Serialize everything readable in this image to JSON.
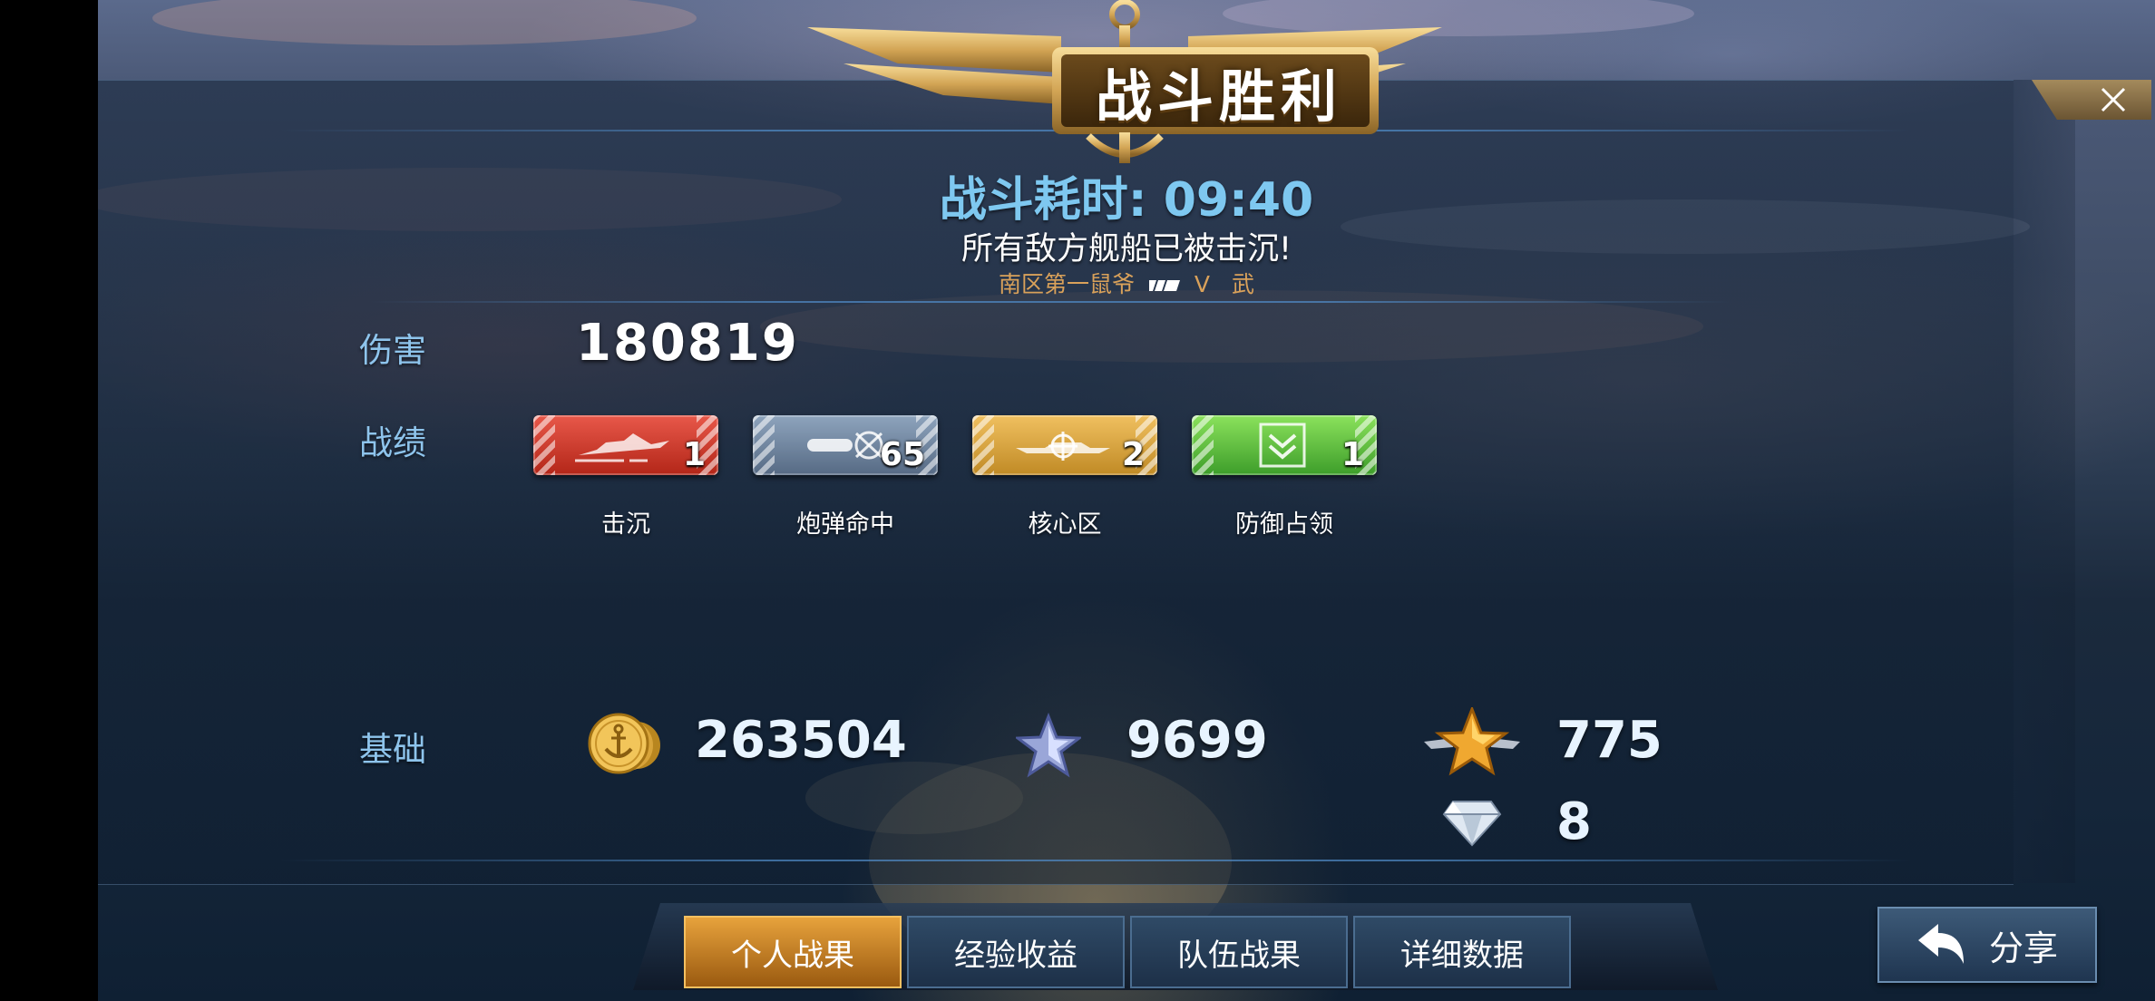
{
  "banner": {
    "title": "战斗胜利"
  },
  "battle": {
    "time_label": "战斗耗时:",
    "time_value": "09:40",
    "message": "所有敌方舰船已被击沉!",
    "mvp_name": "南区第一鼠爷",
    "mvp_rank": "V",
    "mvp_class": "武"
  },
  "damage": {
    "label": "伤害",
    "value": "180819"
  },
  "record": {
    "label": "战绩",
    "medals": [
      {
        "icon": "sunk-ship-icon",
        "count": "1",
        "caption": "击沉",
        "color": "#d33a2b"
      },
      {
        "icon": "shell-hit-icon",
        "count": "65",
        "caption": "炮弹命中",
        "color": "#6f84a0"
      },
      {
        "icon": "core-zone-icon",
        "count": "2",
        "caption": "核心区",
        "color": "#d9a03c"
      },
      {
        "icon": "defense-capture-icon",
        "count": "1",
        "caption": "防御占领",
        "color": "#5cc23c"
      }
    ]
  },
  "base": {
    "label": "基础",
    "gold": "263504",
    "silver_star": "9699",
    "gold_star": "775",
    "diamond": "8"
  },
  "tabs": [
    {
      "label": "个人战果",
      "active": true
    },
    {
      "label": "经验收益",
      "active": false
    },
    {
      "label": "队伍战果",
      "active": false
    },
    {
      "label": "详细数据",
      "active": false
    }
  ],
  "share_label": "分享"
}
